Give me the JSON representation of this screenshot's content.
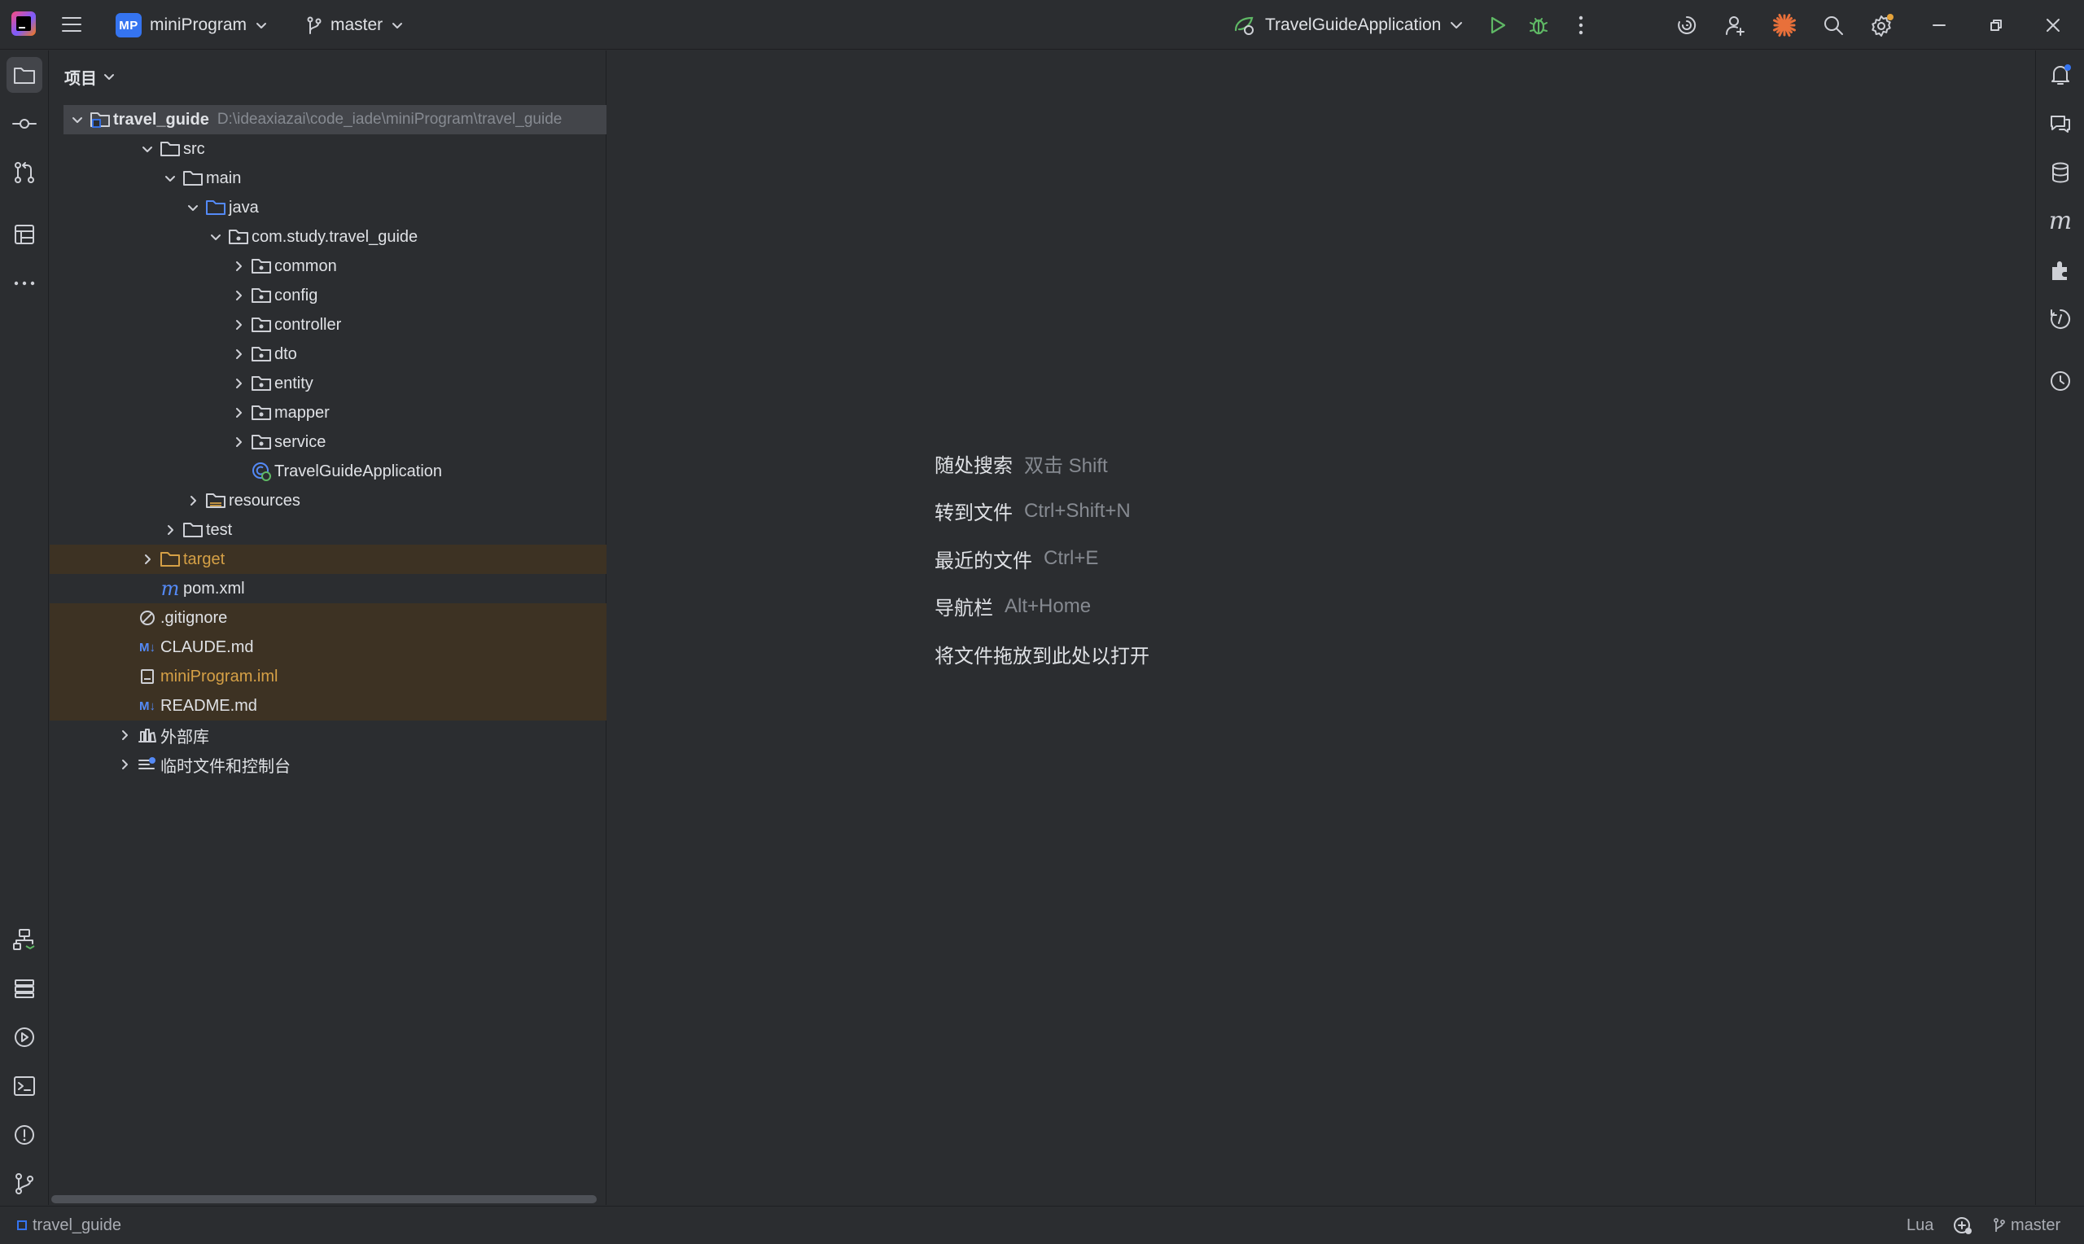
{
  "titlebar": {
    "project_badge": "MP",
    "project_name": "miniProgram",
    "branch": "master",
    "run_config": "TravelGuideApplication"
  },
  "project_panel": {
    "title": "项目",
    "tree": [
      {
        "label": "travel_guide",
        "path": "D:\\ideaxiazai\\code_iade\\miniProgram\\travel_guide"
      },
      {
        "label": "src"
      },
      {
        "label": "main"
      },
      {
        "label": "java"
      },
      {
        "label": "com.study.travel_guide"
      },
      {
        "label": "common"
      },
      {
        "label": "config"
      },
      {
        "label": "controller"
      },
      {
        "label": "dto"
      },
      {
        "label": "entity"
      },
      {
        "label": "mapper"
      },
      {
        "label": "service"
      },
      {
        "label": "TravelGuideApplication"
      },
      {
        "label": "resources"
      },
      {
        "label": "test"
      },
      {
        "label": "target"
      },
      {
        "label": "pom.xml"
      },
      {
        "label": ".gitignore"
      },
      {
        "label": "CLAUDE.md"
      },
      {
        "label": "miniProgram.iml"
      },
      {
        "label": "README.md"
      },
      {
        "label": "外部库"
      },
      {
        "label": "临时文件和控制台"
      }
    ]
  },
  "editor": {
    "hints": [
      {
        "action": "随处搜索",
        "shortcut": "双击 Shift"
      },
      {
        "action": "转到文件",
        "shortcut": "Ctrl+Shift+N"
      },
      {
        "action": "最近的文件",
        "shortcut": "Ctrl+E"
      },
      {
        "action": "导航栏",
        "shortcut": "Alt+Home"
      },
      {
        "action": "将文件拖放到此处以打开",
        "shortcut": ""
      }
    ]
  },
  "statusbar": {
    "breadcrumb": "travel_guide",
    "language": "Lua",
    "branch": "master"
  },
  "colors": {
    "background": "#2b2d30",
    "accent": "#3574f0",
    "selection": "#43454a",
    "ignored_row": "#3d3223",
    "ignored_text": "#d5a046",
    "run_green": "#5fb865"
  }
}
